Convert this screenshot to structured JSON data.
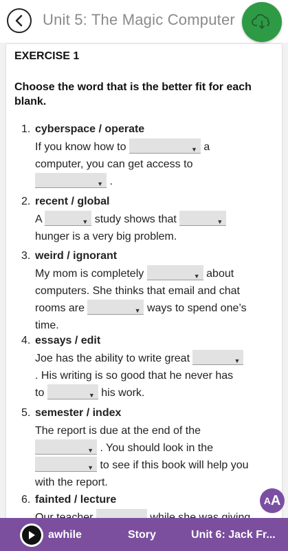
{
  "header": {
    "title": "Unit 5: The Magic Computer",
    "back_icon": "back-arrow-icon",
    "cloud_icon": "cloud-download-icon",
    "cloud_color": "#2e9a45"
  },
  "exercise": {
    "title": "EXERCISE 1",
    "instructions": "Choose the word that is the better fit for each blank."
  },
  "questions": [
    {
      "num": "1.",
      "words": "cyberspace / operate",
      "lines": [
        [
          "If you know how to",
          "a"
        ],
        [
          "computer, you can get access to"
        ],
        [
          "."
        ]
      ]
    },
    {
      "num": "2.",
      "words": "recent / global",
      "lines": [
        [
          "A",
          "study shows that"
        ],
        [
          "hunger is a very big problem."
        ]
      ]
    },
    {
      "num": "3.",
      "words": "weird / ignorant",
      "lines": [
        [
          "My mom is completely",
          "about"
        ],
        [
          "computers. She thinks that email and chat"
        ],
        [
          "rooms are",
          "ways to spend one’s"
        ],
        [
          "time."
        ]
      ]
    },
    {
      "num": "4.",
      "words": "essays / edit",
      "lines": [
        [
          "Joe has the ability to write great"
        ],
        [
          ". His writing is so good that he never has"
        ],
        [
          "to",
          "his work."
        ]
      ]
    },
    {
      "num": "5.",
      "words": "semester / index",
      "lines": [
        [
          "The report is due at the end of the"
        ],
        [
          ". You should look in the"
        ],
        [
          "to see if this book will help you"
        ],
        [
          "with the report."
        ]
      ]
    },
    {
      "num": "6.",
      "words": "fainted / lecture",
      "lines": [
        [
          "Our teacher",
          "while she was giving"
        ]
      ]
    }
  ],
  "font_button": {
    "label_big": "A",
    "label_small": "A"
  },
  "bottom_nav": {
    "play_icon": "play-icon",
    "current": "awhile",
    "middle": "Story",
    "next": "Unit 6: Jack Fr..."
  },
  "colors": {
    "accent": "#7b4f9e",
    "dropdown_bg": "#e2e2e2"
  }
}
